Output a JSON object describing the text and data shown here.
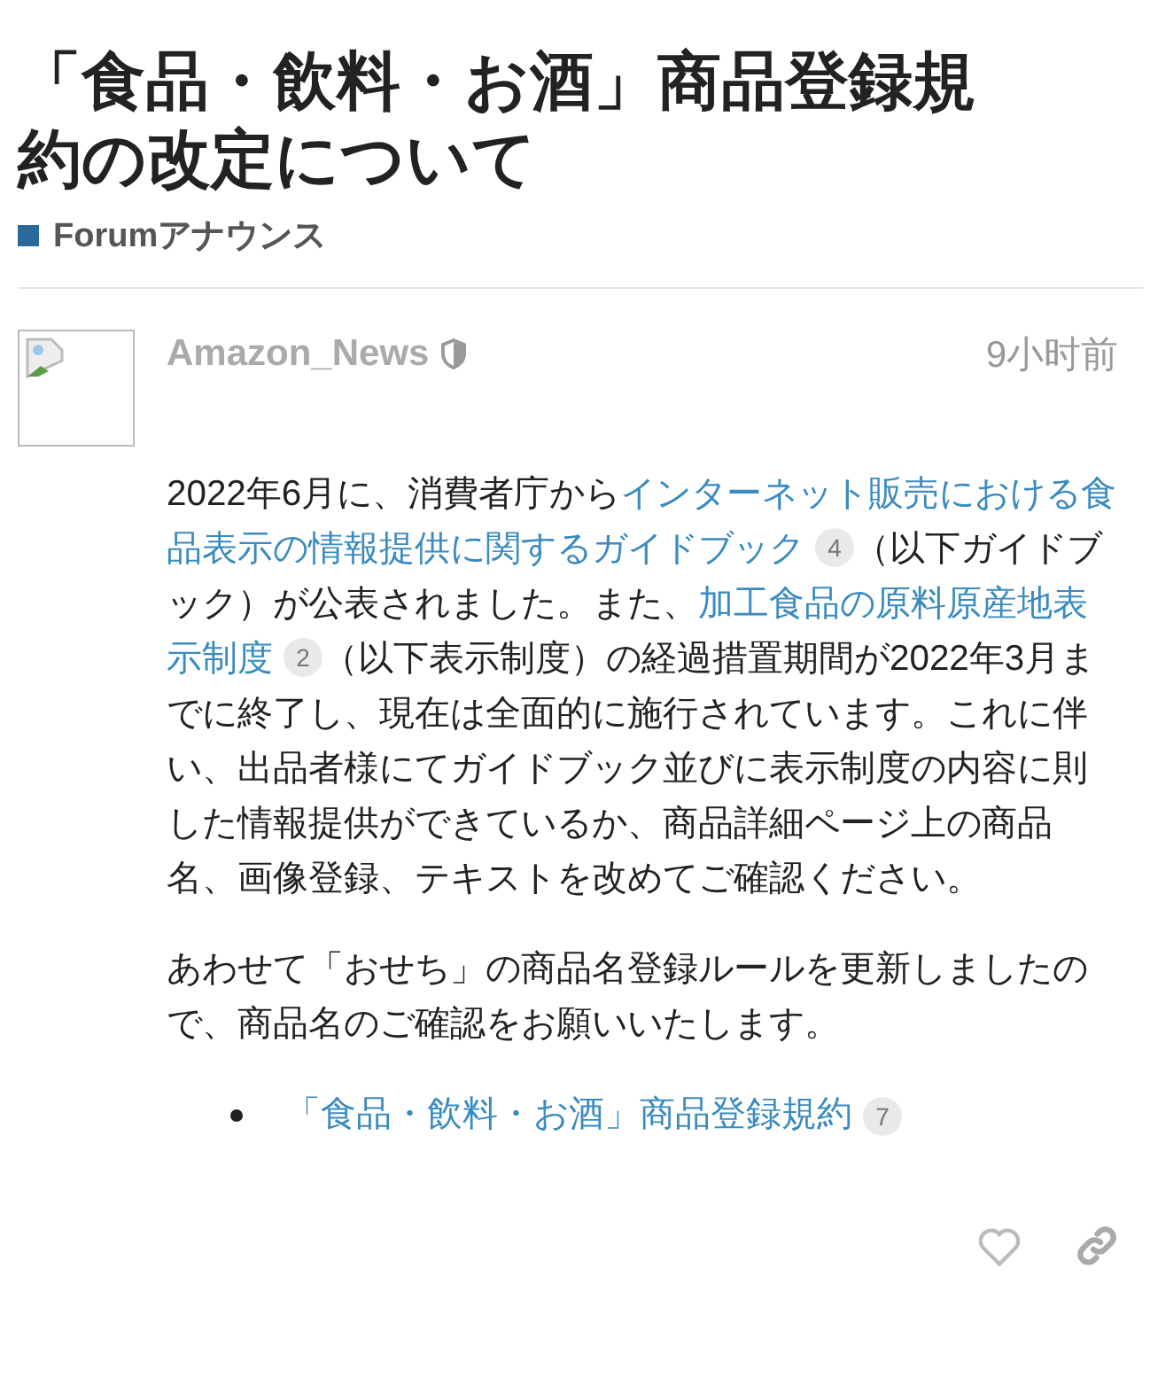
{
  "topic": {
    "title": "「食品・飲料・お酒」商品登録規約の改定について",
    "category": {
      "name": "Forumアナウンス",
      "color": "#2a6a9a"
    }
  },
  "post": {
    "username": "Amazon_News",
    "moderator": true,
    "time": "9小时前",
    "paragraphs": [
      [
        {
          "kind": "text",
          "text": "2022年6月に、消費者庁から"
        },
        {
          "kind": "link",
          "text": "インターネット販売における食品表示の情報提供に関するガイドブック",
          "count": "4"
        },
        {
          "kind": "text",
          "text": "（以下ガイドブック）が公表されました。また、"
        },
        {
          "kind": "link",
          "text": "加工食品の原料原産地表示制度",
          "count": "2"
        },
        {
          "kind": "text",
          "text": "（以下表示制度）の経過措置期間が2022年3月までに終了し、現在は全面的に施行されています。これに伴い、出品者様にてガイドブック並びに表示制度の内容に則した情報提供ができているか、商品詳細ページ上の商品名、画像登録、テキストを改めてご確認ください。"
        }
      ],
      [
        {
          "kind": "text",
          "text": "あわせて「おせち」の商品名登録ルールを更新しましたので、商品名のご確認をお願いいたします。"
        }
      ]
    ],
    "list": [
      {
        "text": "「食品・飲料・お酒」商品登録規約",
        "count": "7"
      }
    ],
    "liked": false
  }
}
